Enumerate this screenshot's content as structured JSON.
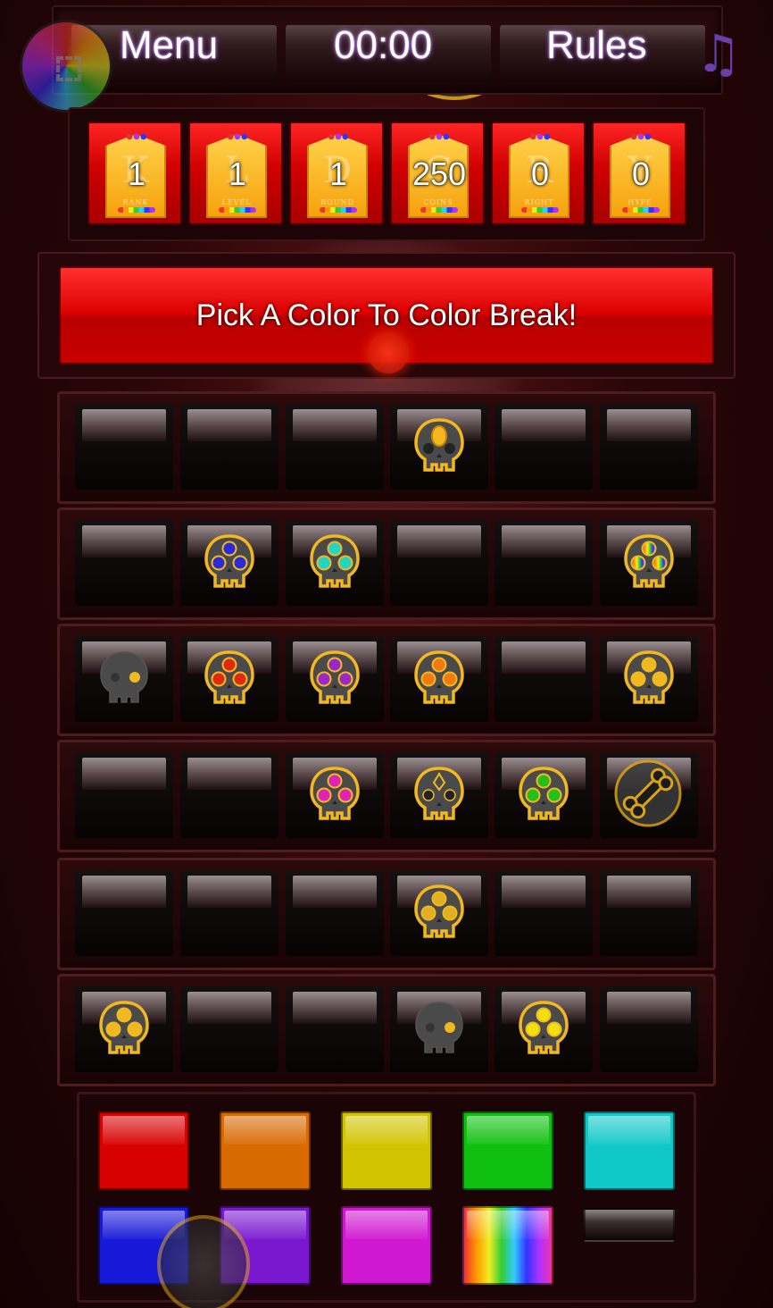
{
  "header": {
    "menu_label": "Menu",
    "timer": "00:00",
    "rules_label": "Rules",
    "music_icon": "♫"
  },
  "stats": [
    {
      "value": "1",
      "letter": "K",
      "label": "RANK"
    },
    {
      "value": "1",
      "letter": "L",
      "label": "LEVEL"
    },
    {
      "value": "1",
      "letter": "D",
      "label": "ROUND"
    },
    {
      "value": "250",
      "letter": "C",
      "label": "COINS"
    },
    {
      "value": "0",
      "letter": "R",
      "label": "RIGHT"
    },
    {
      "value": "0",
      "letter": "Y",
      "label": "HYPE"
    }
  ],
  "message": "Pick A Color To Color Break!",
  "grid": [
    [
      null,
      null,
      null,
      {
        "type": "skull",
        "gem": "#f2b820",
        "style": "single"
      },
      null,
      null
    ],
    [
      null,
      {
        "type": "skull",
        "gem": "#2a2ad8",
        "style": "triple"
      },
      {
        "type": "skull",
        "gem": "#1fd6c8",
        "style": "triple"
      },
      null,
      null,
      {
        "type": "skull",
        "gem": "rainbow",
        "style": "triple"
      }
    ],
    [
      {
        "type": "skull",
        "gem": "#f2b820",
        "style": "dark"
      },
      {
        "type": "skull",
        "gem": "#e02a10",
        "style": "triple"
      },
      {
        "type": "skull",
        "gem": "#9b27c8",
        "style": "triple"
      },
      {
        "type": "skull",
        "gem": "#f07a10",
        "style": "triple"
      },
      null,
      {
        "type": "skull",
        "gem": "#f2b820",
        "style": "triple"
      }
    ],
    [
      null,
      null,
      {
        "type": "skull",
        "gem": "#e023b8",
        "style": "triple"
      },
      {
        "type": "skull",
        "gem": "#f2b820",
        "style": "outline"
      },
      {
        "type": "skull",
        "gem": "#22c01a",
        "style": "triple"
      },
      {
        "type": "bone"
      }
    ],
    [
      null,
      null,
      null,
      {
        "type": "skull",
        "gem": "#e0b020",
        "style": "triple"
      },
      null,
      null
    ],
    [
      {
        "type": "skull",
        "gem": "#f2b820",
        "style": "triple"
      },
      null,
      null,
      {
        "type": "skull",
        "gem": "#f2b820",
        "style": "dark"
      },
      {
        "type": "skull",
        "gem": "#f2e010",
        "style": "triple"
      },
      null
    ]
  ],
  "palette": [
    {
      "name": "red",
      "color": "#d80000"
    },
    {
      "name": "orange",
      "color": "#d86a00"
    },
    {
      "name": "yellow",
      "color": "#d2c400"
    },
    {
      "name": "green",
      "color": "#10c010"
    },
    {
      "name": "cyan",
      "color": "#10c8c8"
    },
    {
      "name": "blue",
      "color": "#1818d8"
    },
    {
      "name": "purple",
      "color": "#7a18d0"
    },
    {
      "name": "magenta",
      "color": "#d018d0"
    },
    {
      "name": "rainbow",
      "color": "rainbow"
    },
    {
      "name": "empty",
      "color": "empty"
    }
  ]
}
